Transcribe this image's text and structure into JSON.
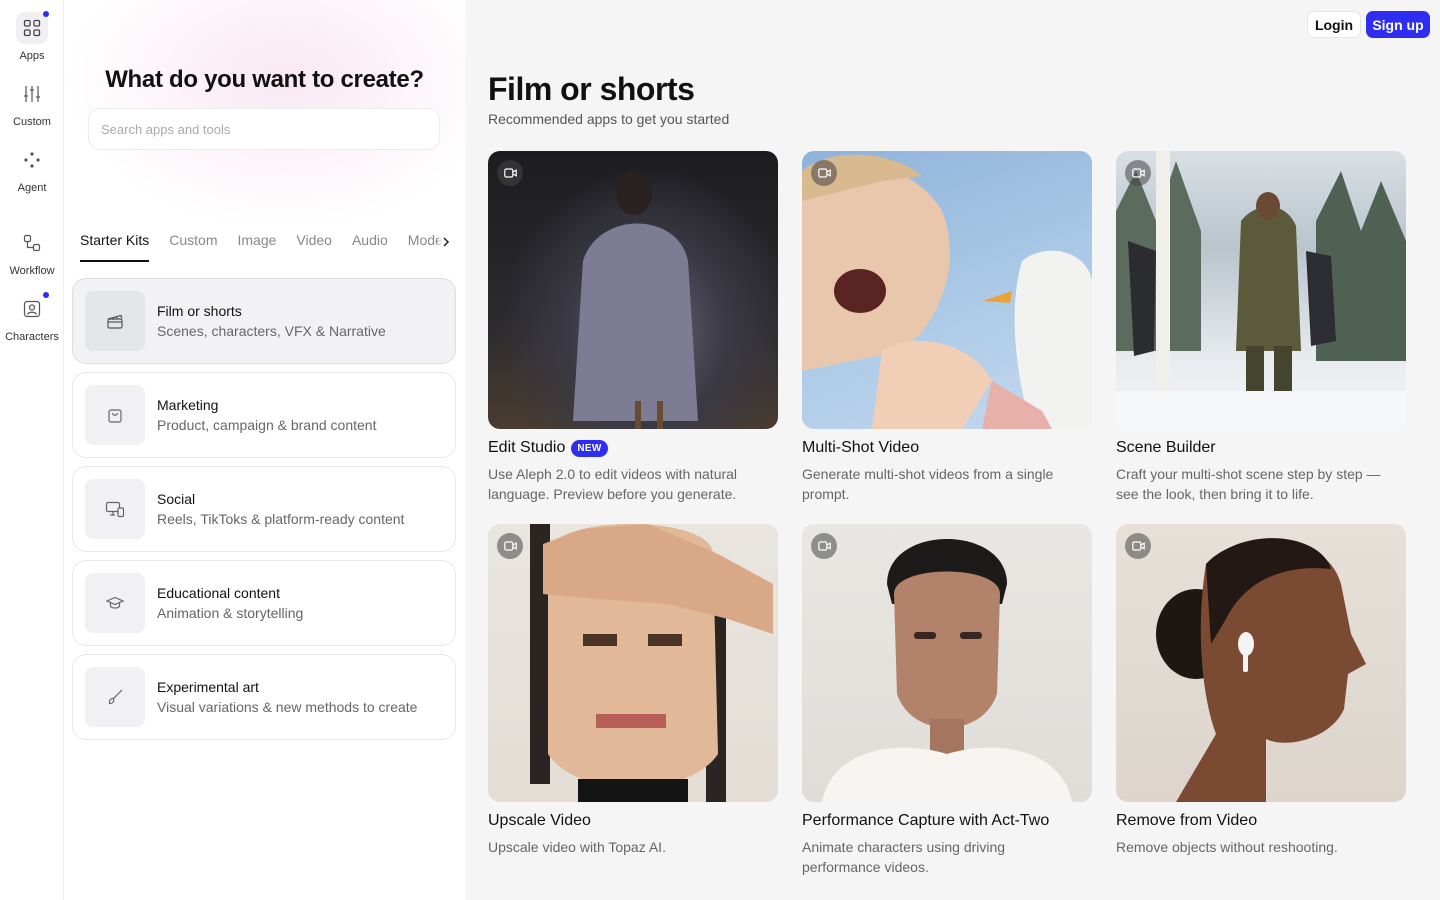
{
  "rail": {
    "items": [
      {
        "label": "Apps",
        "icon": "grid-icon"
      },
      {
        "label": "Custom",
        "icon": "sliders-icon"
      },
      {
        "label": "Agent",
        "icon": "agent-dots-icon"
      },
      {
        "label": "Workflow",
        "icon": "workflow-icon"
      },
      {
        "label": "Characters",
        "icon": "character-icon"
      }
    ],
    "accent": "#2b2ef0"
  },
  "panel": {
    "title": "What do you want to create?",
    "search_placeholder": "Search apps and tools",
    "tabs": [
      "Starter Kits",
      "Custom",
      "Image",
      "Video",
      "Audio",
      "Models"
    ],
    "kits": [
      {
        "title": "Film or shorts",
        "subtitle": "Scenes, characters, VFX & Narrative",
        "icon": "clapperboard-icon"
      },
      {
        "title": "Marketing",
        "subtitle": "Product, campaign & brand content",
        "icon": "shopping-bag-icon"
      },
      {
        "title": "Social",
        "subtitle": "Reels, TikToks & platform-ready content",
        "icon": "devices-icon"
      },
      {
        "title": "Educational content",
        "subtitle": "Animation & storytelling",
        "icon": "graduation-cap-icon"
      },
      {
        "title": "Experimental art",
        "subtitle": "Visual variations & new methods to create",
        "icon": "brush-icon"
      }
    ]
  },
  "header": {
    "login_label": "Login",
    "signup_label": "Sign up",
    "signup_color": "#2e2df0"
  },
  "main": {
    "title": "Film or shorts",
    "subtitle": "Recommended apps to get you started",
    "cards": [
      {
        "title": "Edit Studio",
        "badge": "NEW",
        "description": "Use Aleph 2.0 to edit videos with natural language. Preview before you generate."
      },
      {
        "title": "Multi-Shot Video",
        "description": "Generate multi-shot videos from a single prompt."
      },
      {
        "title": "Scene Builder",
        "description": "Craft your multi-shot scene step by step — see the look, then bring it to life."
      },
      {
        "title": "Upscale Video",
        "description": "Upscale video with Topaz AI."
      },
      {
        "title": "Performance Capture with Act-Two",
        "description": "Animate characters using driving performance videos."
      },
      {
        "title": "Remove from Video",
        "description": "Remove objects without reshooting."
      }
    ]
  }
}
